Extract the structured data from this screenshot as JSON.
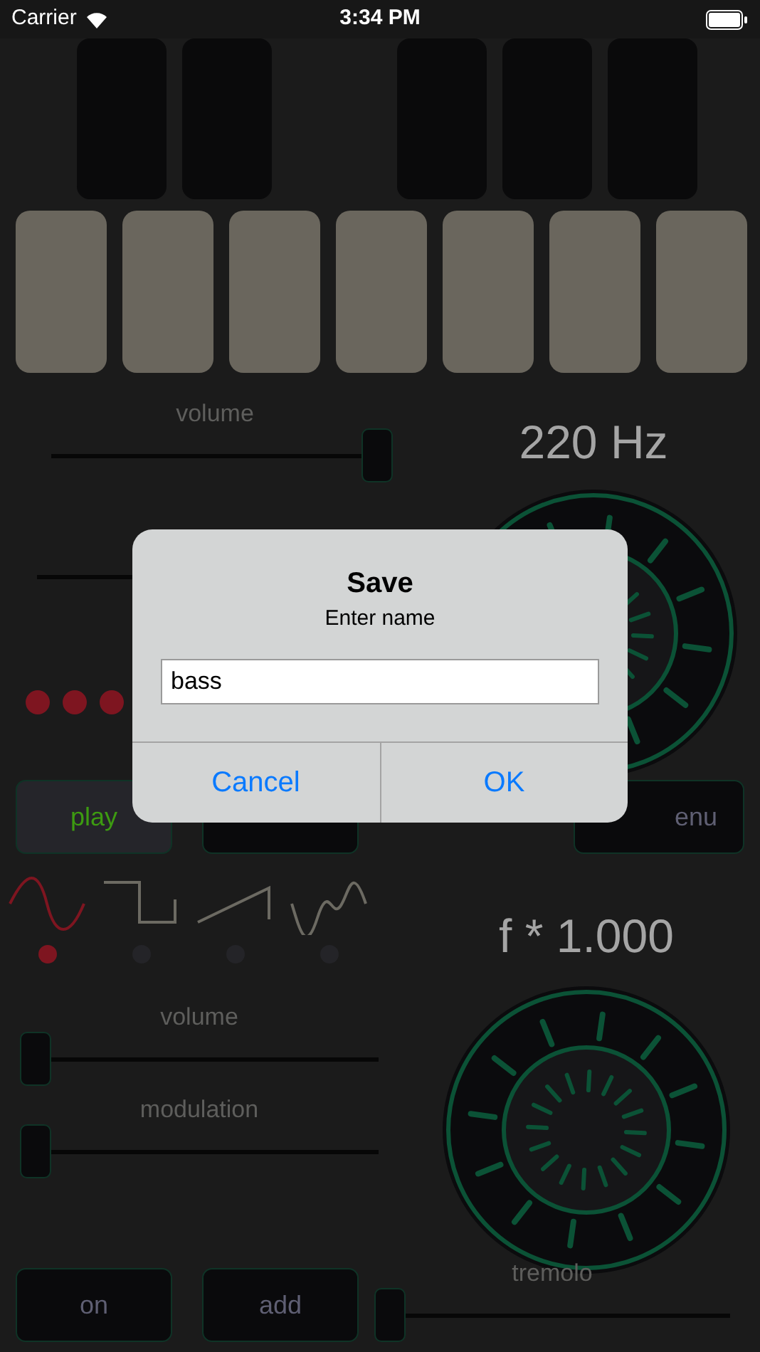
{
  "status_bar": {
    "carrier": "Carrier",
    "time": "3:34 PM"
  },
  "synth": {
    "volume": {
      "label": "volume",
      "level": 1
    },
    "frequency": "220 Hz",
    "buttons": [
      {
        "label": "play",
        "active": true
      },
      {
        "active": false
      },
      {
        "label": "enu",
        "active": false
      }
    ],
    "waveforms": [
      {
        "kind": "sine",
        "selected": true
      },
      {
        "kind": "square",
        "selected": false
      },
      {
        "kind": "saw",
        "selected": false
      },
      {
        "kind": "custom",
        "selected": false
      }
    ],
    "multiplier": "f * 1.000",
    "sliders": [
      {
        "label": "volume",
        "level": 0
      },
      {
        "label": "modulation",
        "level": 0
      }
    ],
    "bottom_buttons": [
      {
        "label": "on"
      },
      {
        "label": "add"
      }
    ],
    "tremolo": {
      "label": "tremolo",
      "level": 0
    }
  },
  "dialog": {
    "title": "Save",
    "message": "Enter name",
    "input": {
      "value": "bass"
    },
    "buttons": [
      {
        "label": "Cancel"
      },
      {
        "label": "OK"
      }
    ]
  }
}
